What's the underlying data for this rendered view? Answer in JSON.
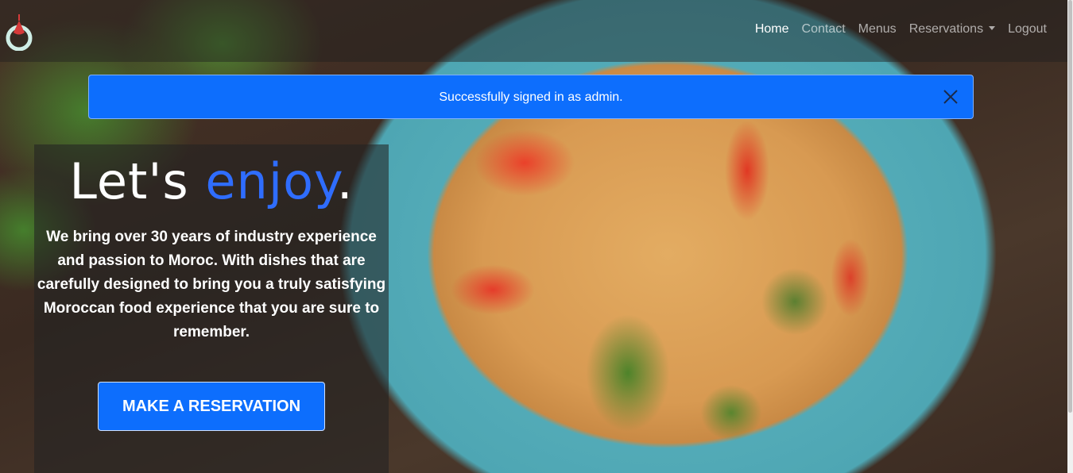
{
  "nav": {
    "items": [
      {
        "label": "Home",
        "active": true
      },
      {
        "label": "Contact"
      },
      {
        "label": "Menus"
      },
      {
        "label": "Reservations",
        "dropdown": true
      },
      {
        "label": "Logout"
      }
    ]
  },
  "alert": {
    "message": "Successfully signed in as admin."
  },
  "hero": {
    "headline_part1": "Let's",
    "headline_accent": "enjoy",
    "headline_end": ".",
    "blurb": "We bring over 30 years of industry experience and passion to Moroc. With dishes that are carefully designed to bring you a truly satisfying Moroccan food experience that you are sure to remember.",
    "cta_label": "MAKE A RESERVATION"
  },
  "colors": {
    "primary": "#0d6efd",
    "accent_text": "#2f6dff"
  }
}
